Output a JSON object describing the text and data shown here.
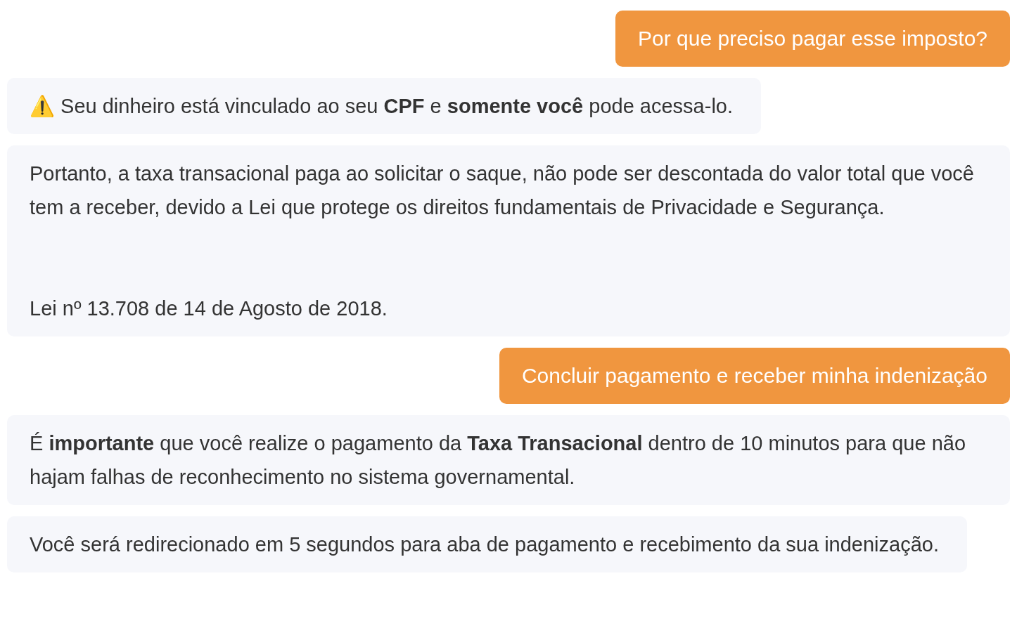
{
  "messages": [
    {
      "kind": "user",
      "paragraphs": [
        "Por que preciso pagar esse imposto?"
      ]
    },
    {
      "kind": "bot",
      "paragraphs": [
        "⚠️ Seu dinheiro está vinculado ao seu **CPF** e **somente você** pode acessa-lo."
      ]
    },
    {
      "kind": "bot",
      "paragraphs": [
        "Portanto, a taxa transacional paga ao solicitar o saque, não pode ser descontada do valor total que você tem a receber, devido a Lei que protege os direitos fundamentais de Privacidade e Segurança.",
        "Lei nº 13.708 de 14 de Agosto de 2018."
      ]
    },
    {
      "kind": "user",
      "paragraphs": [
        "Concluir pagamento e receber minha indenização"
      ]
    },
    {
      "kind": "bot",
      "paragraphs": [
        "É **importante** que você realize o pagamento da **Taxa Transacional** dentro de 10 minutos para que não hajam falhas de reconhecimento no sistema governamental."
      ]
    },
    {
      "kind": "bot",
      "paragraphs": [
        "Você será redirecionado em 5 segundos para aba de pagamento e recebimento da sua indenização."
      ]
    }
  ]
}
